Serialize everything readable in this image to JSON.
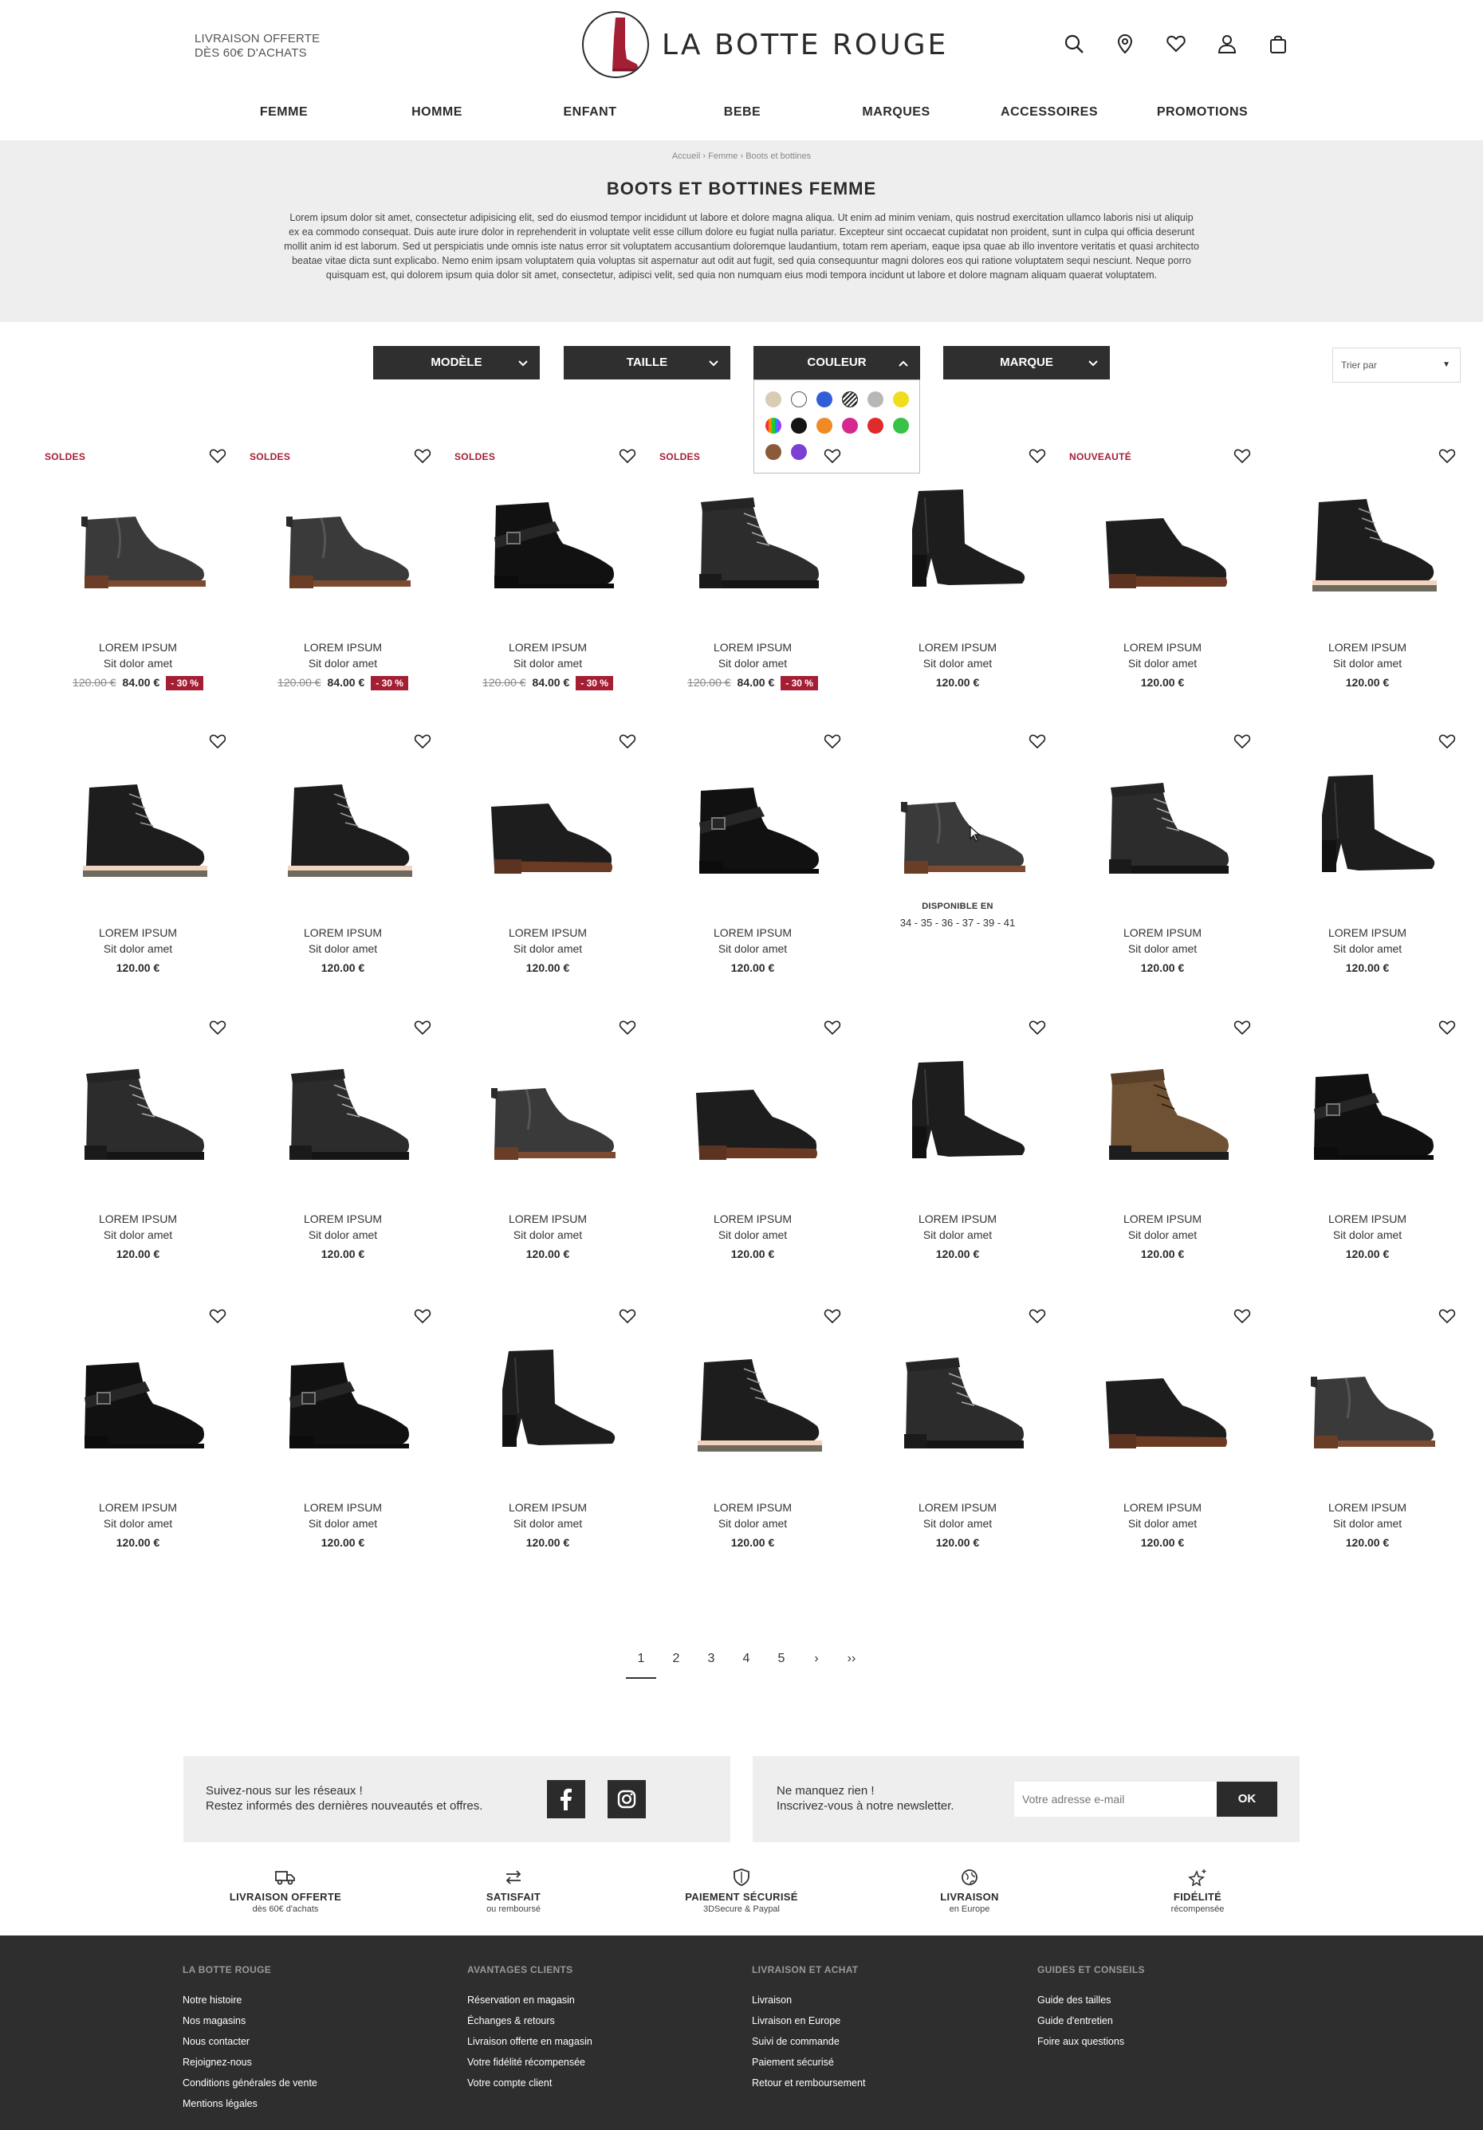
{
  "header": {
    "promo_line1": "LIVRAISON OFFERTE",
    "promo_line2": "DÈS 60€ D'ACHATS",
    "logo_text": "LA BOTTE ROUGE",
    "icons": [
      "search-icon",
      "location-pin-icon",
      "heart-icon",
      "user-icon",
      "shopping-bag-icon"
    ]
  },
  "nav": [
    "FEMME",
    "HOMME",
    "ENFANT",
    "BEBE",
    "MARQUES",
    "ACCESSOIRES",
    "PROMOTIONS"
  ],
  "breadcrumb": {
    "items": [
      "Accueil",
      "Femme",
      "Boots et bottines"
    ],
    "separator": "›"
  },
  "hero": {
    "title": "BOOTS ET BOTTINES FEMME",
    "description": "Lorem ipsum dolor sit amet, consectetur adipisicing elit, sed do eiusmod tempor incididunt ut labore et dolore magna aliqua. Ut enim ad minim veniam, quis nostrud exercitation ullamco laboris nisi ut aliquip ex ea commodo consequat. Duis aute irure dolor in reprehenderit in voluptate velit esse cillum dolore eu fugiat nulla pariatur. Excepteur sint occaecat cupidatat non proident, sunt in culpa qui officia deserunt mollit anim id est laborum. Sed ut perspiciatis unde omnis iste natus error sit voluptatem accusantium doloremque laudantium, totam rem aperiam, eaque ipsa quae ab illo inventore veritatis et quasi architecto beatae vitae dicta sunt explicabo. Nemo enim ipsam voluptatem quia voluptas sit aspernatur aut odit aut fugit, sed quia consequuntur magni dolores eos qui ratione voluptatem sequi nesciunt. Neque porro quisquam est, qui dolorem ipsum quia dolor sit amet, consectetur, adipisci velit, sed quia non numquam eius modi tempora incidunt ut labore et dolore magnam aliquam quaerat voluptatem."
  },
  "filters": {
    "model": "MODÈLE",
    "size": "TAILLE",
    "color": "COULEUR",
    "brand": "MARQUE",
    "sort_label": "Trier par",
    "color_swatches": [
      "#d8ccb3",
      "#ffffff",
      "#2f5ed6",
      "striped",
      "#b7b7b7",
      "#f1dc1e",
      "multicolor",
      "#151515",
      "#f08a24",
      "#d72890",
      "#df2b2b",
      "#37c248",
      "#8a5a3a",
      "#7b3fd6"
    ]
  },
  "labels": {
    "sale": "SOLDES",
    "new": "NOUVEAUTÉ",
    "available_in": "DISPONIBLE EN",
    "available_sizes": "34 - 35 - 36 - 37 - 39 - 41"
  },
  "products": {
    "row1": [
      {
        "name": "LOREM IPSUM",
        "sub": "Sit dolor amet",
        "badge": "SOLDES",
        "old": "120.00 €",
        "price": "84.00 €",
        "discount": "- 30 %",
        "style": "chelsea"
      },
      {
        "name": "LOREM IPSUM",
        "sub": "Sit dolor amet",
        "badge": "SOLDES",
        "old": "120.00 €",
        "price": "84.00 €",
        "discount": "- 30 %",
        "style": "chelsea"
      },
      {
        "name": "LOREM IPSUM",
        "sub": "Sit dolor amet",
        "badge": "SOLDES",
        "old": "120.00 €",
        "price": "84.00 €",
        "discount": "- 30 %",
        "style": "strap"
      },
      {
        "name": "LOREM IPSUM",
        "sub": "Sit dolor amet",
        "badge": "SOLDES",
        "old": "120.00 €",
        "price": "84.00 €",
        "discount": "- 30 %",
        "style": "lace"
      },
      {
        "name": "LOREM IPSUM",
        "sub": "Sit dolor amet",
        "badge": "",
        "price": "120.00 €",
        "style": "heel"
      },
      {
        "name": "LOREM IPSUM",
        "sub": "Sit dolor amet",
        "badge": "NOUVEAUTÉ",
        "price": "120.00 €",
        "style": "ankle"
      },
      {
        "name": "LOREM IPSUM",
        "sub": "Sit dolor amet",
        "badge": "",
        "price": "120.00 €",
        "style": "lacesole"
      }
    ],
    "row2": [
      {
        "name": "LOREM IPSUM",
        "sub": "Sit dolor amet",
        "price": "120.00 €",
        "style": "lacesole"
      },
      {
        "name": "LOREM IPSUM",
        "sub": "Sit dolor amet",
        "price": "120.00 €",
        "style": "lacesole"
      },
      {
        "name": "LOREM IPSUM",
        "sub": "Sit dolor amet",
        "price": "120.00 €",
        "style": "ankle"
      },
      {
        "name": "LOREM IPSUM",
        "sub": "Sit dolor amet",
        "price": "120.00 €",
        "style": "strap"
      },
      {
        "name": "",
        "sub": "",
        "price": "",
        "style": "chelsea",
        "hover": true
      },
      {
        "name": "LOREM IPSUM",
        "sub": "Sit dolor amet",
        "price": "120.00 €",
        "style": "lace"
      },
      {
        "name": "LOREM IPSUM",
        "sub": "Sit dolor amet",
        "price": "120.00 €",
        "style": "heel"
      }
    ],
    "row3": [
      {
        "name": "LOREM IPSUM",
        "sub": "Sit dolor amet",
        "price": "120.00 €",
        "style": "lace"
      },
      {
        "name": "LOREM IPSUM",
        "sub": "Sit dolor amet",
        "price": "120.00 €",
        "style": "lace"
      },
      {
        "name": "LOREM IPSUM",
        "sub": "Sit dolor amet",
        "price": "120.00 €",
        "style": "chelsea"
      },
      {
        "name": "LOREM IPSUM",
        "sub": "Sit dolor amet",
        "price": "120.00 €",
        "style": "ankle"
      },
      {
        "name": "LOREM IPSUM",
        "sub": "Sit dolor amet",
        "price": "120.00 €",
        "style": "heel"
      },
      {
        "name": "LOREM IPSUM",
        "sub": "Sit dolor amet",
        "price": "120.00 €",
        "style": "brown"
      },
      {
        "name": "LOREM IPSUM",
        "sub": "Sit dolor amet",
        "price": "120.00 €",
        "style": "strap"
      }
    ],
    "row4": [
      {
        "name": "LOREM IPSUM",
        "sub": "Sit dolor amet",
        "price": "120.00 €",
        "style": "strap"
      },
      {
        "name": "LOREM IPSUM",
        "sub": "Sit dolor amet",
        "price": "120.00 €",
        "style": "strap"
      },
      {
        "name": "LOREM IPSUM",
        "sub": "Sit dolor amet",
        "price": "120.00 €",
        "style": "heel"
      },
      {
        "name": "LOREM IPSUM",
        "sub": "Sit dolor amet",
        "price": "120.00 €",
        "style": "lacesole"
      },
      {
        "name": "LOREM IPSUM",
        "sub": "Sit dolor amet",
        "price": "120.00 €",
        "style": "lace"
      },
      {
        "name": "LOREM IPSUM",
        "sub": "Sit dolor amet",
        "price": "120.00 €",
        "style": "ankle"
      },
      {
        "name": "LOREM IPSUM",
        "sub": "Sit dolor amet",
        "price": "120.00 €",
        "style": "chelsea"
      }
    ]
  },
  "pagination": {
    "pages": [
      "1",
      "2",
      "3",
      "4",
      "5"
    ],
    "next": "›",
    "last": "››",
    "current": "1"
  },
  "social": {
    "line1": "Suivez-nous sur les réseaux !",
    "line2": "Restez informés des dernières nouveautés et offres."
  },
  "newsletter": {
    "line1": "Ne manquez rien !",
    "line2": "Inscrivez-vous à notre newsletter.",
    "placeholder": "Votre adresse e-mail",
    "button": "OK"
  },
  "reassurance": [
    {
      "title": "LIVRAISON OFFERTE",
      "sub": "dès 60€ d'achats",
      "icon": "truck-icon"
    },
    {
      "title": "SATISFAIT",
      "sub": "ou remboursé",
      "icon": "exchange-arrows-icon"
    },
    {
      "title": "PAIEMENT SÉCURISÉ",
      "sub": "3DSecure & Paypal",
      "icon": "shield-icon"
    },
    {
      "title": "LIVRAISON",
      "sub": "en Europe",
      "icon": "globe-icon"
    },
    {
      "title": "FIDÉLITÉ",
      "sub": "récompensée",
      "icon": "star-sparkle-icon"
    }
  ],
  "footer": [
    {
      "title": "LA BOTTE ROUGE",
      "links": [
        "Notre histoire",
        "Nos magasins",
        "Nous contacter",
        "Rejoignez-nous",
        "Conditions générales de vente",
        "Mentions légales"
      ]
    },
    {
      "title": "AVANTAGES CLIENTS",
      "links": [
        "Réservation en magasin",
        "Échanges & retours",
        "Livraison offerte en magasin",
        "Votre fidélité récompensée",
        "Votre compte client"
      ]
    },
    {
      "title": "LIVRAISON ET ACHAT",
      "links": [
        "Livraison",
        "Livraison en Europe",
        "Suivi de commande",
        "Paiement sécurisé",
        "Retour et remboursement"
      ]
    },
    {
      "title": "GUIDES ET CONSEILS",
      "links": [
        "Guide des tailles",
        "Guide d'entretien",
        "Foire aux questions"
      ]
    }
  ],
  "colors": {
    "accent": "#a41e34",
    "dark": "#2f2f2f",
    "footer_bg": "#2e2e2e",
    "hero_bg": "#eeeeee"
  }
}
